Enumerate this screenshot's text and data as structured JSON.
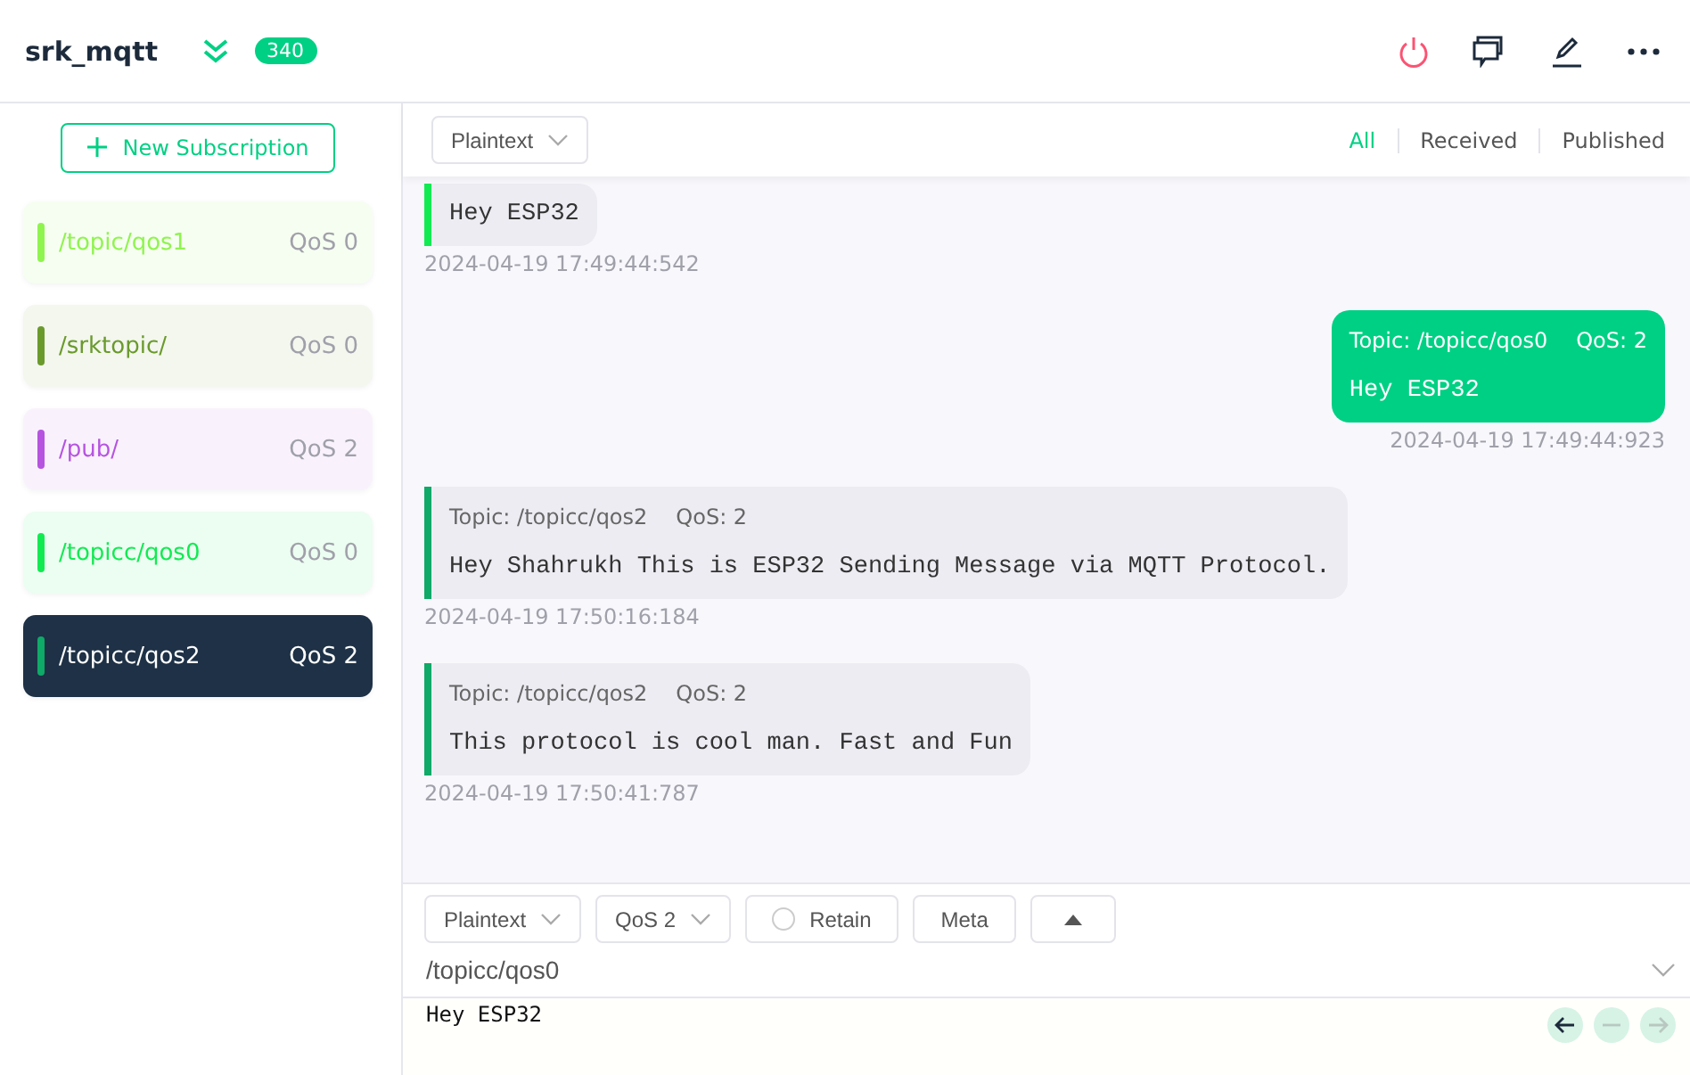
{
  "header": {
    "title": "srk_mqtt",
    "badge": "340"
  },
  "sidebar": {
    "new_button": "New Subscription",
    "items": [
      {
        "topic": "/topic/qos1",
        "qos": "QoS 0",
        "color": "#8ff44f",
        "selected": false
      },
      {
        "topic": "/srktopic/",
        "qos": "QoS 0",
        "color": "#6a9a2c",
        "selected": false
      },
      {
        "topic": "/pub/",
        "qos": "QoS 2",
        "color": "#b654e0",
        "selected": false
      },
      {
        "topic": "/topicc/qos0",
        "qos": "QoS 0",
        "color": "#12ea52",
        "selected": false
      },
      {
        "topic": "/topicc/qos2",
        "qos": "QoS 2",
        "color": "#0fa968",
        "selected": true
      }
    ]
  },
  "toolbar": {
    "format": "Plaintext",
    "filters": [
      {
        "label": "All",
        "selected": true
      },
      {
        "label": "Received",
        "selected": false
      },
      {
        "label": "Published",
        "selected": false
      }
    ]
  },
  "messages": [
    {
      "kind": "received",
      "color": "#12ea52",
      "payload": "Hey ESP32",
      "time": "2024-04-19 17:49:44:542"
    },
    {
      "kind": "sent",
      "topic": "Topic: /topicc/qos0",
      "qos": "QoS: 2",
      "payload": "Hey ESP32",
      "time": "2024-04-19 17:49:44:923"
    },
    {
      "kind": "received",
      "color": "#0fa968",
      "topic": "Topic: /topicc/qos2",
      "qos": "QoS: 2",
      "payload": "Hey Shahrukh This is ESP32 Sending Message via MQTT Protocol.",
      "time": "2024-04-19 17:50:16:184"
    },
    {
      "kind": "received",
      "color": "#0fa968",
      "topic": "Topic: /topicc/qos2",
      "qos": "QoS: 2",
      "payload": "This protocol is cool man. Fast and Fun",
      "time": "2024-04-19 17:50:41:787"
    }
  ],
  "composer": {
    "format": "Plaintext",
    "qos": "QoS 2",
    "retain": {
      "label": "Retain",
      "checked": false
    },
    "meta": "Meta",
    "topic": "/topicc/qos0",
    "payload": "Hey ESP32"
  }
}
